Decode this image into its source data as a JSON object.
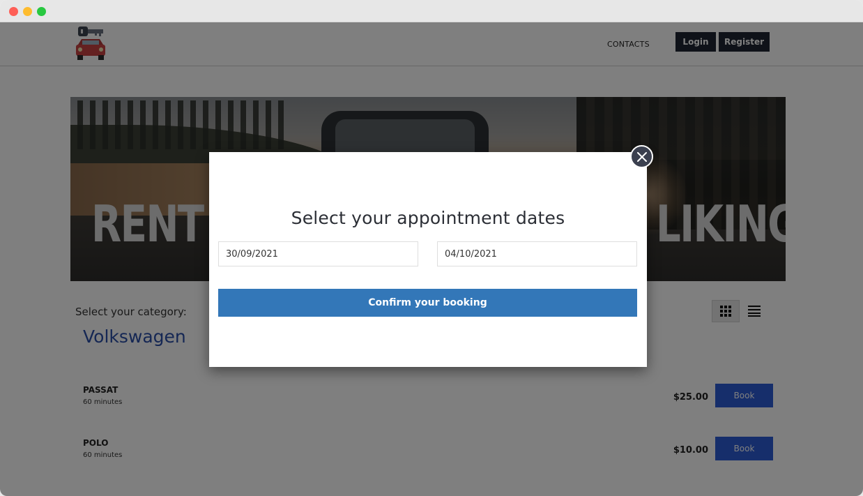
{
  "header": {
    "nav_contacts": "CONTACTS",
    "login_label": "Login",
    "register_label": "Register"
  },
  "hero": {
    "text_left": "RENT A",
    "text_right": "LIKING!"
  },
  "catalog": {
    "category_label": "Select your category:",
    "category_title": "Volkswagen",
    "items": [
      {
        "name": "PASSAT",
        "duration": "60 minutes",
        "price": "$25.00",
        "book_label": "Book"
      },
      {
        "name": "POLO",
        "duration": "60 minutes",
        "price": "$10.00",
        "book_label": "Book"
      }
    ]
  },
  "modal": {
    "title": "Select your appointment dates",
    "start_date": "30/09/2021",
    "end_date": "04/10/2021",
    "confirm_label": "Confirm your booking"
  },
  "icons": {
    "close": "close-icon",
    "grid_view": "grid-view-icon",
    "list_view": "list-view-icon",
    "logo": "car-key-logo-icon"
  },
  "colors": {
    "header_button": "#1f2533",
    "book_button": "#2c5cd6",
    "confirm_button": "#3377b8",
    "category_title": "#2a4fa8",
    "close_button": "#3b404f"
  }
}
